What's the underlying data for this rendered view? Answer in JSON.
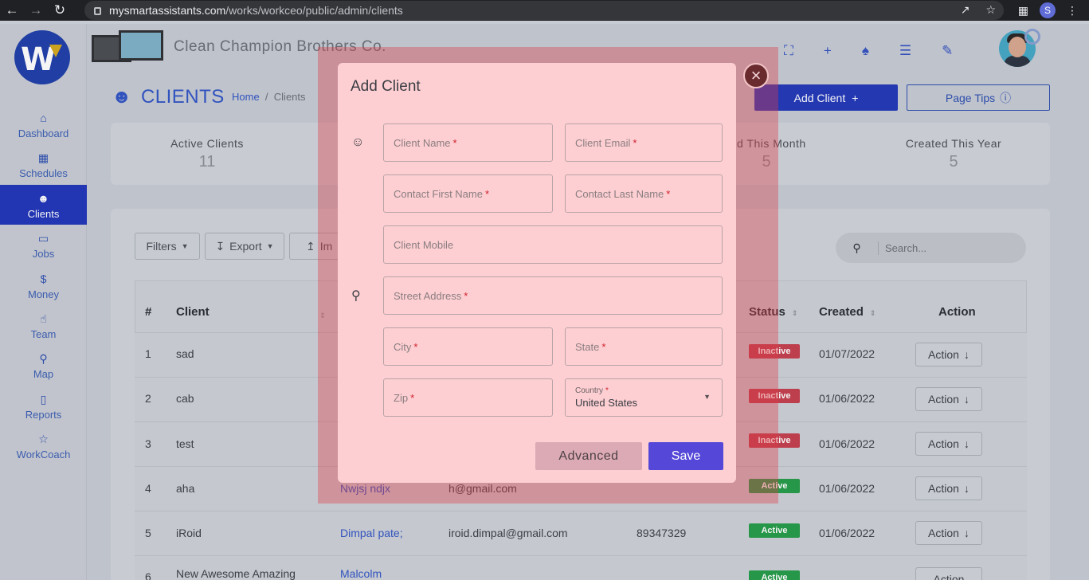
{
  "browser": {
    "url_domain": "mysmartassistants.com",
    "url_path": "/works/workceo/public/admin/clients",
    "profile_initial": "S"
  },
  "header": {
    "company_name": "Clean Champion Brothers Co."
  },
  "sidebar": {
    "items": [
      {
        "label": "Dashboard",
        "icon": "home-icon",
        "active": false
      },
      {
        "label": "Schedules",
        "icon": "calendar-icon",
        "active": false
      },
      {
        "label": "Clients",
        "icon": "users-icon",
        "active": true
      },
      {
        "label": "Jobs",
        "icon": "clipboard-icon",
        "active": false
      },
      {
        "label": "Money",
        "icon": "dollar-icon",
        "active": false
      },
      {
        "label": "Team",
        "icon": "thumbs-up-icon",
        "active": false
      },
      {
        "label": "Map",
        "icon": "map-pin-icon",
        "active": false
      },
      {
        "label": "Reports",
        "icon": "bar-chart-icon",
        "active": false
      },
      {
        "label": "WorkCoach",
        "icon": "star-icon",
        "active": false
      }
    ]
  },
  "page": {
    "title": "CLIENTS",
    "breadcrumb_home": "Home",
    "breadcrumb_sep": "/",
    "breadcrumb_current": "Clients",
    "add_client_label": "Add Client",
    "page_tips_label": "Page Tips"
  },
  "stats": [
    {
      "label": "Active Clients",
      "value": "11"
    },
    {
      "label": "ted This Month",
      "value": "5"
    },
    {
      "label": "Created This Year",
      "value": "5"
    }
  ],
  "toolbar": {
    "filters_label": "Filters",
    "export_label": "Export",
    "import_label": "Im",
    "search_placeholder": "Search..."
  },
  "table": {
    "headers": {
      "num": "#",
      "client": "Client",
      "status": "Status",
      "created": "Created",
      "action": "Action"
    },
    "rows": [
      {
        "num": "1",
        "client": "sad",
        "contact": "",
        "email": "",
        "phone": "",
        "status": "Inactive",
        "created": "01/07/2022",
        "action": "Action"
      },
      {
        "num": "2",
        "client": "cab",
        "contact": "",
        "email": "",
        "phone": "",
        "status": "Inactive",
        "created": "01/06/2022",
        "action": "Action"
      },
      {
        "num": "3",
        "client": "test",
        "contact": "",
        "email": "",
        "phone": "",
        "status": "Inactive",
        "created": "01/06/2022",
        "action": "Action"
      },
      {
        "num": "4",
        "client": "aha",
        "contact": "Nwjsj ndjx",
        "email": "h@gmail.com",
        "phone": "",
        "status": "Active",
        "created": "01/06/2022",
        "action": "Action"
      },
      {
        "num": "5",
        "client": "iRoid",
        "contact": "Dimpal pate;",
        "email": "iroid.dimpal@gmail.com",
        "phone": "89347329",
        "status": "Active",
        "created": "01/06/2022",
        "action": "Action"
      },
      {
        "num": "6",
        "client": "New Awesome Amazing",
        "contact": "Malcolm",
        "email": "",
        "phone": "",
        "status": "Active",
        "created": "",
        "action": "Action"
      }
    ]
  },
  "modal": {
    "title": "Add Client",
    "close_symbol": "×",
    "fields": {
      "client_name": "Client Name",
      "client_email": "Client Email",
      "contact_first_name": "Contact First Name",
      "contact_last_name": "Contact Last Name",
      "client_mobile": "Client Mobile",
      "street_address": "Street Address",
      "city": "City",
      "state": "State",
      "zip": "Zip",
      "country_label": "Country",
      "country_value": "United States"
    },
    "required_mark": "*",
    "advanced_label": "Advanced",
    "save_label": "Save"
  }
}
